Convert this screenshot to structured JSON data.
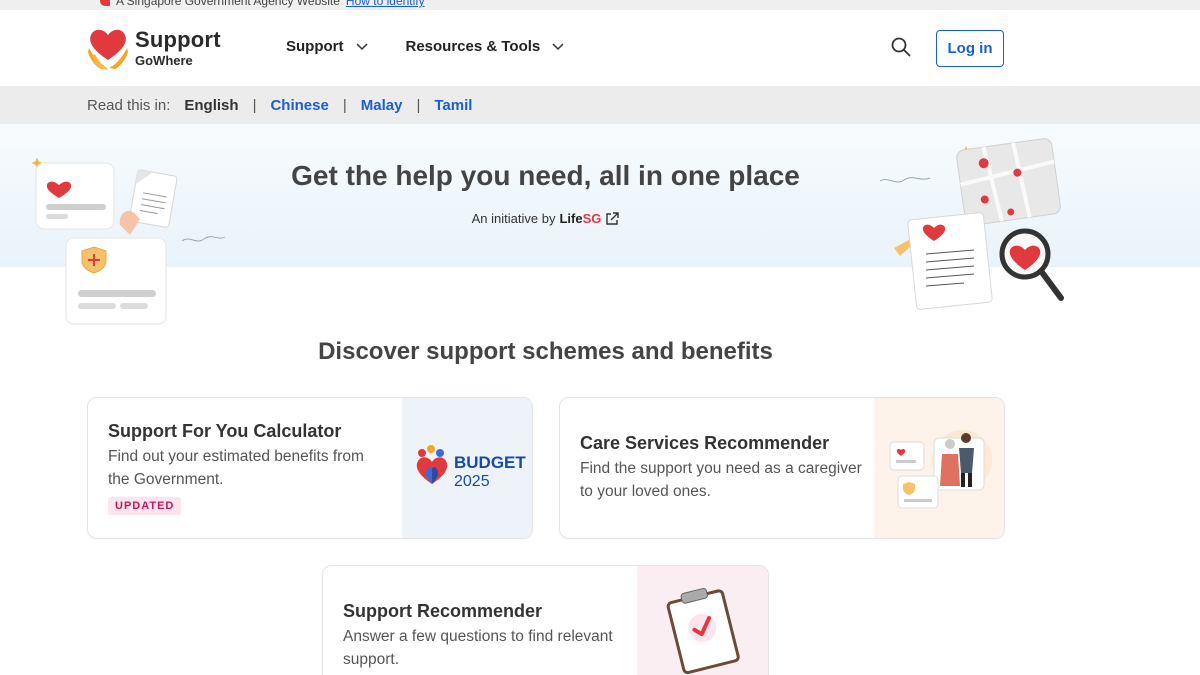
{
  "gov_banner": {
    "text": "A Singapore Government Agency Website",
    "link": "How to identify"
  },
  "header": {
    "logo_main": "Support",
    "logo_sub": "GoWhere",
    "nav": [
      {
        "label": "Support"
      },
      {
        "label": "Resources & Tools"
      }
    ],
    "login_label": "Log in"
  },
  "lang_bar": {
    "label": "Read this in:",
    "current": "English",
    "options": [
      "Chinese",
      "Malay",
      "Tamil"
    ]
  },
  "hero": {
    "title": "Get the help you need, all in one place",
    "initiative_prefix": "An initiative by",
    "initiative_brand_a": "Life",
    "initiative_brand_b": "SG"
  },
  "section": {
    "title": "Discover support schemes and benefits"
  },
  "cards": [
    {
      "title": "Support For You Calculator",
      "desc": "Find out your estimated benefits from the Government.",
      "badge": "UPDATED",
      "image_text_a": "BUDGET",
      "image_text_b": "2025"
    },
    {
      "title": "Care Services Recommender",
      "desc": "Find the support you need as a caregiver to your loved ones."
    },
    {
      "title": "Support Recommender",
      "desc": "Answer a few questions to find relevant support."
    }
  ],
  "colors": {
    "brand_red": "#e03a3e",
    "link_blue": "#1a5ed4",
    "badge_bg": "#fde4ee",
    "badge_text": "#c2185b"
  }
}
